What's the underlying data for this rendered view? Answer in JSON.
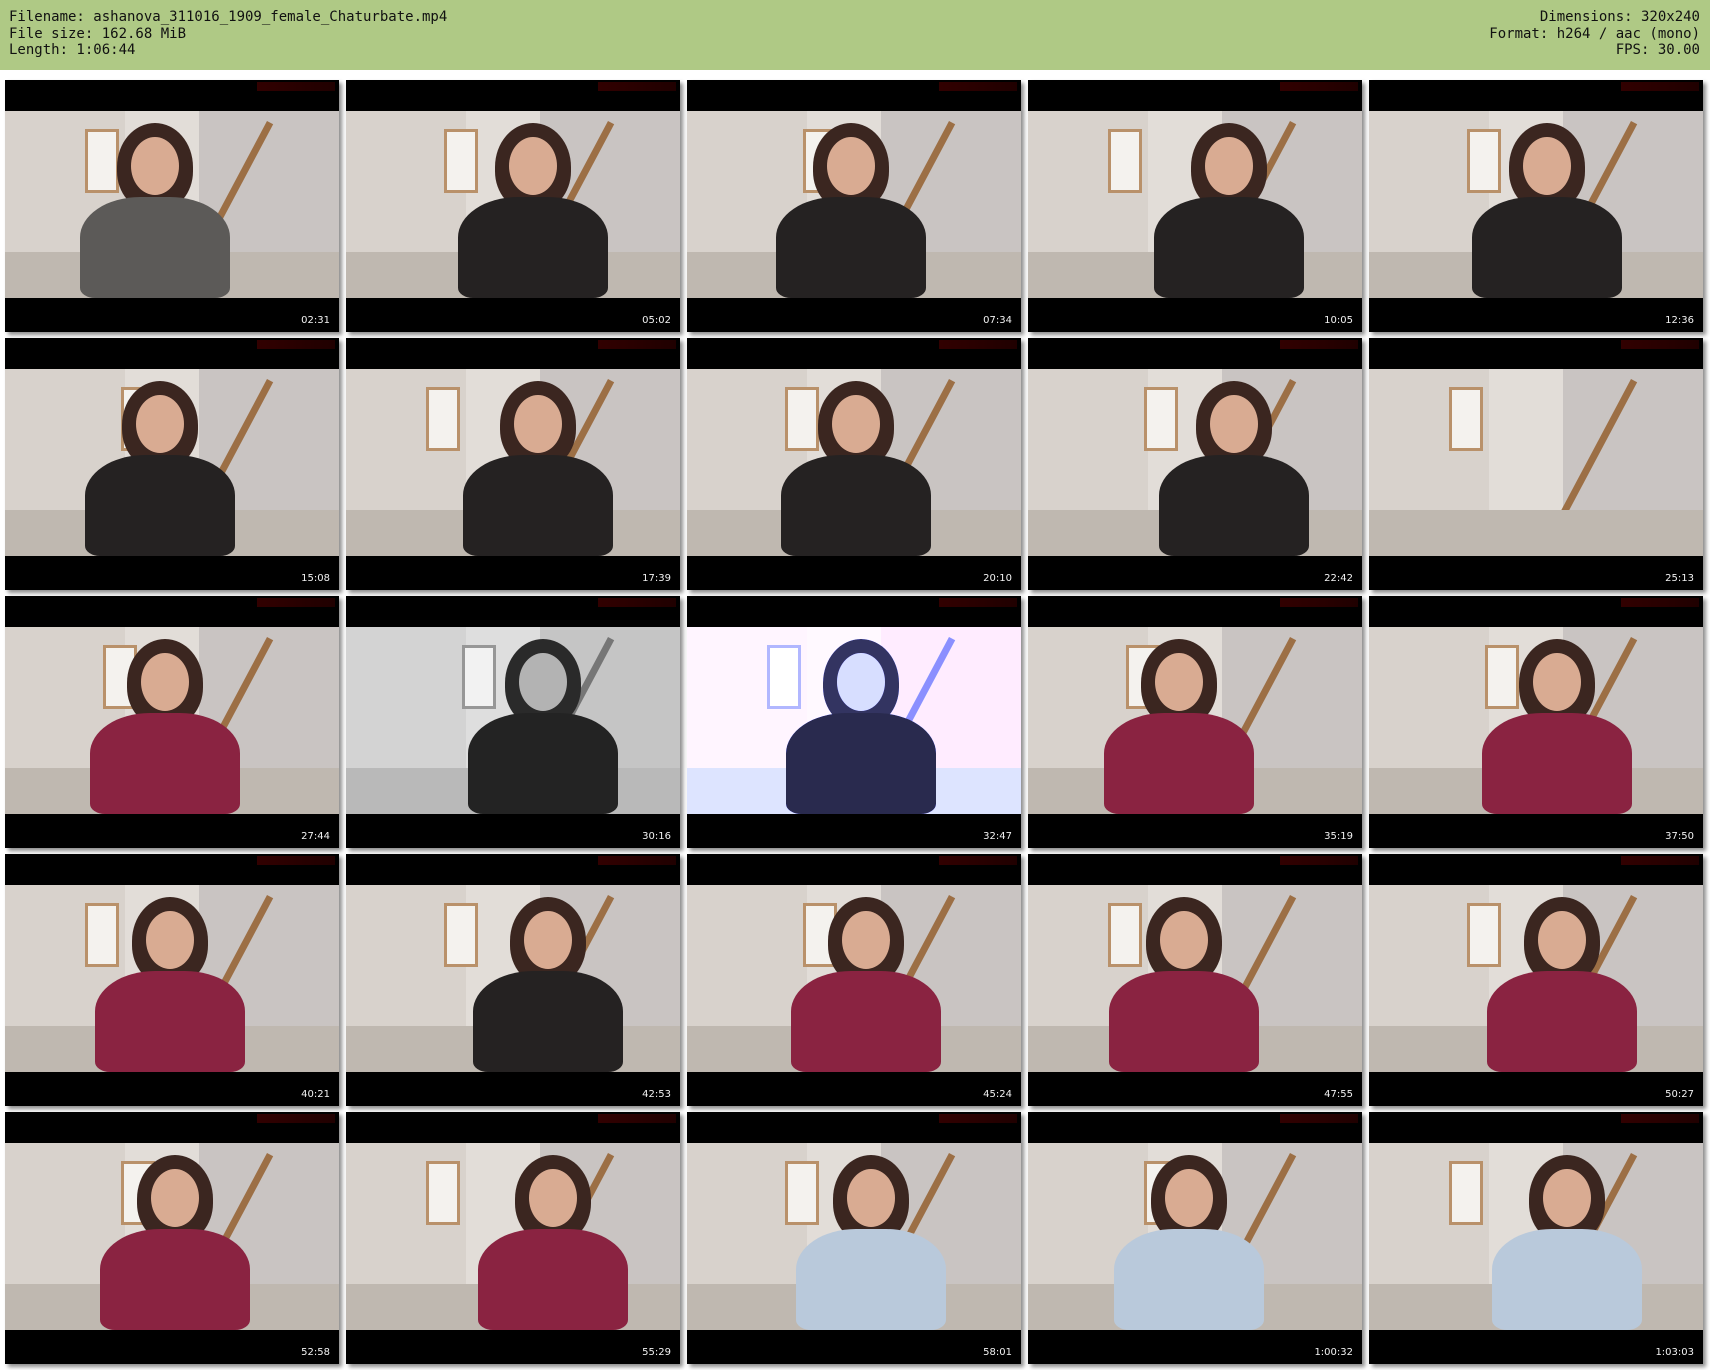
{
  "header": {
    "filename": "Filename: ashanova_311016_1909_female_Chaturbate.mp4",
    "filesize": "File size: 162.68 MiB",
    "length": "Length: 1:06:44",
    "dimensions": "Dimensions: 320x240",
    "format": "Format: h264 / aac (mono)",
    "fps": "FPS: 30.00"
  },
  "colors": {
    "header_bg": "#afc985",
    "thumb_bg": "#000000"
  },
  "thumbnails": [
    {
      "time": "02:31",
      "tint": "normal",
      "outfit": "grey"
    },
    {
      "time": "05:02",
      "tint": "normal",
      "outfit": "black"
    },
    {
      "time": "07:34",
      "tint": "normal",
      "outfit": "black"
    },
    {
      "time": "10:05",
      "tint": "normal",
      "outfit": "black"
    },
    {
      "time": "12:36",
      "tint": "normal",
      "outfit": "black"
    },
    {
      "time": "15:08",
      "tint": "normal",
      "outfit": "black"
    },
    {
      "time": "17:39",
      "tint": "normal",
      "outfit": "black"
    },
    {
      "time": "20:10",
      "tint": "normal",
      "outfit": "black"
    },
    {
      "time": "22:42",
      "tint": "normal",
      "outfit": "black"
    },
    {
      "time": "25:13",
      "tint": "normal",
      "outfit": "none"
    },
    {
      "time": "27:44",
      "tint": "normal",
      "outfit": "red"
    },
    {
      "time": "30:16",
      "tint": "grayscale",
      "outfit": "black"
    },
    {
      "time": "32:47",
      "tint": "blue",
      "outfit": "black"
    },
    {
      "time": "35:19",
      "tint": "normal",
      "outfit": "red"
    },
    {
      "time": "37:50",
      "tint": "normal",
      "outfit": "red"
    },
    {
      "time": "40:21",
      "tint": "normal",
      "outfit": "red"
    },
    {
      "time": "42:53",
      "tint": "normal",
      "outfit": "black"
    },
    {
      "time": "45:24",
      "tint": "normal",
      "outfit": "red"
    },
    {
      "time": "47:55",
      "tint": "normal",
      "outfit": "red"
    },
    {
      "time": "50:27",
      "tint": "normal",
      "outfit": "red"
    },
    {
      "time": "52:58",
      "tint": "normal",
      "outfit": "red"
    },
    {
      "time": "55:29",
      "tint": "normal",
      "outfit": "red"
    },
    {
      "time": "58:01",
      "tint": "normal",
      "outfit": "light-blue"
    },
    {
      "time": "1:00:32",
      "tint": "normal",
      "outfit": "light-blue"
    },
    {
      "time": "1:03:03",
      "tint": "normal",
      "outfit": "light-blue"
    }
  ]
}
